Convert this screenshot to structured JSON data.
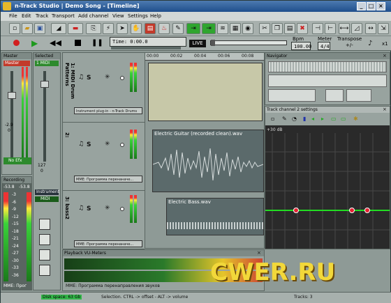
{
  "window": {
    "title": "n-Track Studio | Demo Song - [Timeline]",
    "min": "_",
    "max": "□",
    "close": "×"
  },
  "menu": [
    "File",
    "Edit",
    "Track",
    "Transport",
    "Add channel",
    "View",
    "Settings",
    "Help"
  ],
  "toolbar": {
    "time_label": "Time: 0:00.0",
    "live_label": "LIVE",
    "bpm_label": "Bpm",
    "bpm_value": "100.00",
    "meter_label": "Meter",
    "meter_value": "4/4",
    "transpose_label": "Transpose",
    "transpose_value": "+/-",
    "zoom_label": "x1"
  },
  "mixer": {
    "master_title": "Master",
    "master_strip": "Master",
    "master_db": "-2.9",
    "master_db2": "0",
    "no_efx": "No Efx",
    "recording_title": "Recording",
    "recording_left": "-53.8",
    "recording_right": "-53.8",
    "scale": [
      "-3",
      "-6",
      "-9",
      "-12",
      "-15",
      "-18",
      "-21",
      "-24",
      "-27",
      "-30",
      "-33",
      "-36"
    ],
    "mme_label": "MME: Прог",
    "selected_title": "Selected",
    "selected_strip": "1 MIDI",
    "selected_db": "127",
    "selected_db2": "0",
    "instrument_label": "Instrument",
    "midi_label": "MIDI"
  },
  "tracks": [
    {
      "name": "1: MIDI Drum Patterns",
      "device": "Instrument plug-in - n-Track Drums",
      "mute": "S"
    },
    {
      "name": "2:",
      "device": "MME: Программа перенаначе...",
      "mute": "S"
    },
    {
      "name": "3: bass2",
      "device": "MME: Программа перенаначе...",
      "mute": "S"
    }
  ],
  "timeline": {
    "ruler": [
      "00:00",
      "00:02",
      "00:04",
      "00:06",
      "00:08"
    ],
    "clips": [
      "Electric Guitar (recorded clean).wav",
      "Electric Bass.wav"
    ]
  },
  "navigator": {
    "title": "Navigator"
  },
  "eq": {
    "title": "Track channel 2 settings",
    "db_top": "+30 dB",
    "nodes": [
      "1",
      "2",
      "3"
    ]
  },
  "playback": {
    "title": "Playback VU-Meters",
    "device": "MME: Программа перенаправления звуков"
  },
  "status": {
    "disk": "Disk space: 63 Gb",
    "hint": "Selection. CTRL -> offset - ALT -> volume",
    "tracks": "Tracks: 3"
  },
  "watermark": "CWER.RU",
  "colors": {
    "accent": "#1f4f8c",
    "meter_green": "#3ad23a",
    "eq_curve": "#22dd22",
    "eq_node": "#e22233"
  }
}
